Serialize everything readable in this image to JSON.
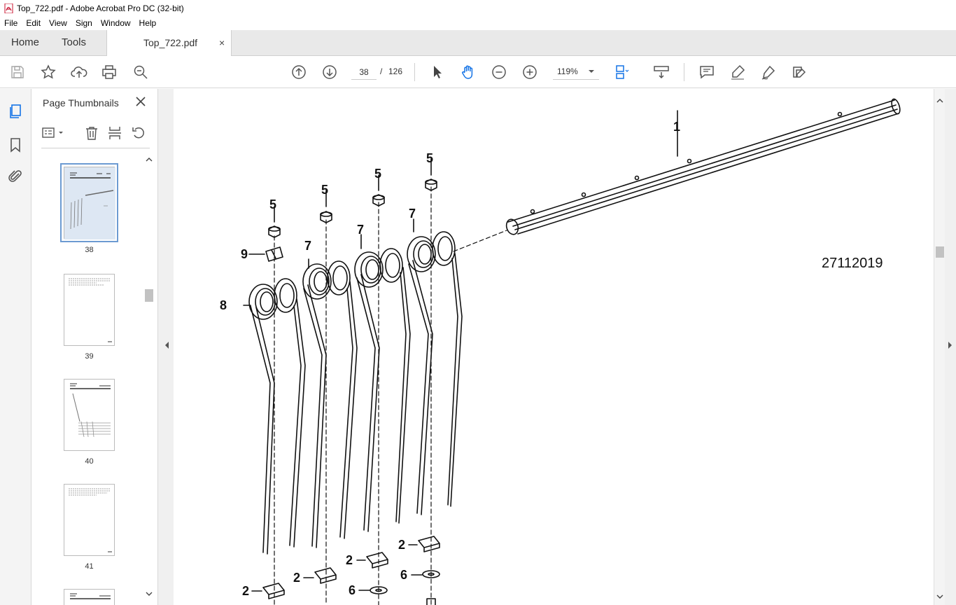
{
  "window": {
    "title": "Top_722.pdf - Adobe Acrobat Pro DC (32-bit)",
    "app_icon": "acrobat-icon"
  },
  "menu": {
    "items": [
      "File",
      "Edit",
      "View",
      "Sign",
      "Window",
      "Help"
    ]
  },
  "tabs": {
    "home_label": "Home",
    "tools_label": "Tools",
    "document_label": "Top_722.pdf",
    "close_glyph": "×"
  },
  "toolbar": {
    "current_page": "38",
    "page_separator": "/",
    "total_pages": "126",
    "zoom": "119%",
    "icons": [
      "save-icon",
      "star-icon",
      "upload-icon",
      "print-icon",
      "zoom-search-icon",
      "page-up-icon",
      "page-down-icon",
      "select-arrow-icon",
      "hand-tool-icon",
      "zoom-out-icon",
      "zoom-in-icon",
      "fit-page-icon",
      "scroll-mode-icon",
      "comment-icon",
      "highlight-icon",
      "sign-icon",
      "edit-pdf-icon"
    ]
  },
  "thumbnails_panel": {
    "title": "Page Thumbnails",
    "pages": [
      {
        "label": "38",
        "selected": true
      },
      {
        "label": "39",
        "selected": false
      },
      {
        "label": "40",
        "selected": false
      },
      {
        "label": "41",
        "selected": false
      }
    ]
  },
  "document": {
    "drawing_id": "27112019",
    "part_labels": {
      "shaft": "1",
      "nut": "5",
      "spring_tine": "7",
      "spring_tine_end": "8",
      "clip": "9",
      "clamp": "2",
      "washer": "6"
    }
  }
}
